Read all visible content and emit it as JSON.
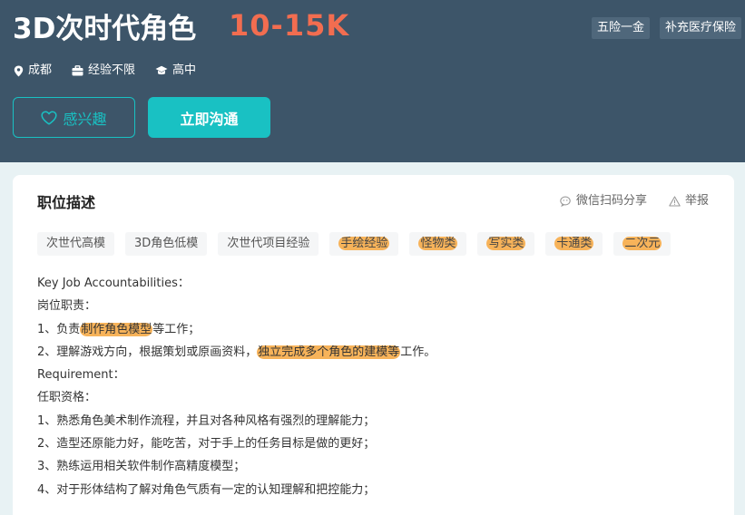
{
  "job": {
    "title": "3D次时代角色",
    "salary": "10-15K",
    "benefits": [
      "五险一金",
      "补充医疗保险"
    ],
    "city": "成都",
    "experience": "经验不限",
    "education": "高中"
  },
  "actions": {
    "interest_label": "感兴趣",
    "chat_label": "立即沟通"
  },
  "section": {
    "title": "职位描述",
    "share_label": "微信扫码分享",
    "report_label": "举报"
  },
  "tags": [
    {
      "label": "次世代高模",
      "highlighted": false
    },
    {
      "label": "3D角色低模",
      "highlighted": false
    },
    {
      "label": "次世代项目经验",
      "highlighted": false
    },
    {
      "label": "手绘经验",
      "highlighted": true
    },
    {
      "label": "怪物类",
      "highlighted": true
    },
    {
      "label": "写实类",
      "highlighted": true
    },
    {
      "label": "卡通类",
      "highlighted": true
    },
    {
      "label": "二次元",
      "highlighted": true
    }
  ],
  "description": {
    "l1": "Key Job Accountabilities：",
    "l2": "岗位职责：",
    "l3a": "1、负责",
    "l3b": "制作角色模型",
    "l3c": "等工作；",
    "l4a": "2、理解游戏方向，根据策划或原画资料，",
    "l4b": "独立完成多个角色的建模等",
    "l4c": "工作。",
    "l5": "Requirement：",
    "l6": "任职资格：",
    "l7": "1、熟悉角色美术制作流程，并且对各种风格有强烈的理解能力；",
    "l8": "2、造型还原能力好，能吃苦，对于手上的任务目标是做的更好；",
    "l9": "3、熟练运用相关软件制作高精度模型；",
    "l10": "4、对于形体结构了解对角色气质有一定的认知理解和把控能力；"
  },
  "colors": {
    "header_bg": "#3d5569",
    "accent": "#19c1c3",
    "salary": "#f26d50",
    "highlight": "#f7b35a"
  }
}
